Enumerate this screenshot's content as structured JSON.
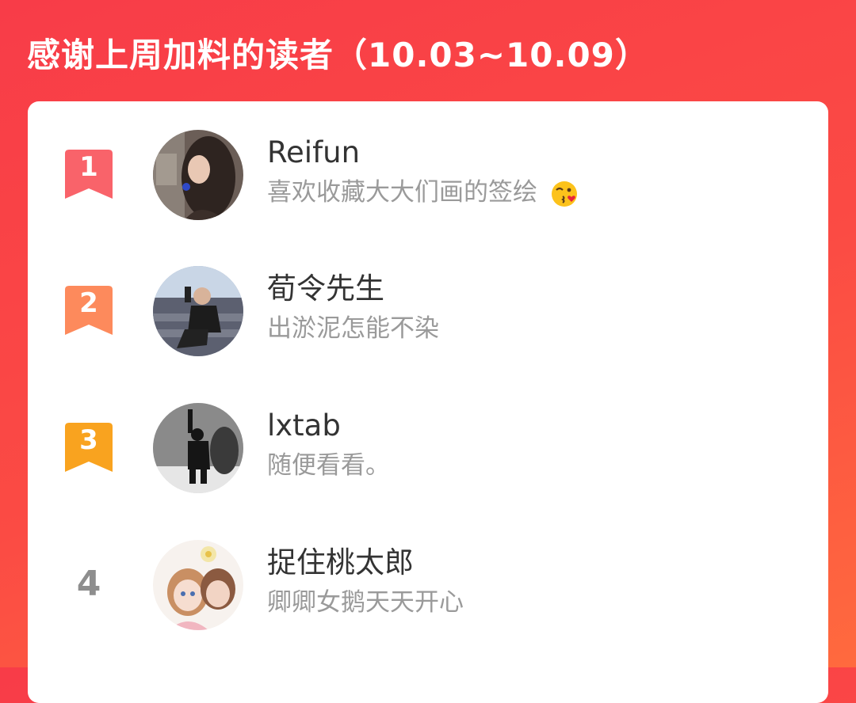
{
  "header": {
    "title": "感谢上周加料的读者（10.03~10.09）"
  },
  "colors": {
    "background_start": "#f83c48",
    "background_end": "#ff6a3e",
    "rank1": "#f9636a",
    "rank2": "#fd8a5c",
    "rank3": "#f9a31f",
    "name_text": "#333333",
    "message_text": "#9a9a9a"
  },
  "readers": [
    {
      "rank": "1",
      "name": "Reifun",
      "message": "喜欢收藏大大们画的签绘",
      "message_emoji": "kissing-face-emoji",
      "avatar": "avatar-photo-girl"
    },
    {
      "rank": "2",
      "name": "荀令先生",
      "message": "出淤泥怎能不染",
      "avatar": "avatar-photo-skater"
    },
    {
      "rank": "3",
      "name": "lxtab",
      "message": "随便看看。",
      "avatar": "avatar-photo-bw-figure"
    },
    {
      "rank": "4",
      "name": "捉住桃太郎",
      "message": "卿卿女鹅天天开心",
      "avatar": "avatar-illustration-couple"
    }
  ]
}
